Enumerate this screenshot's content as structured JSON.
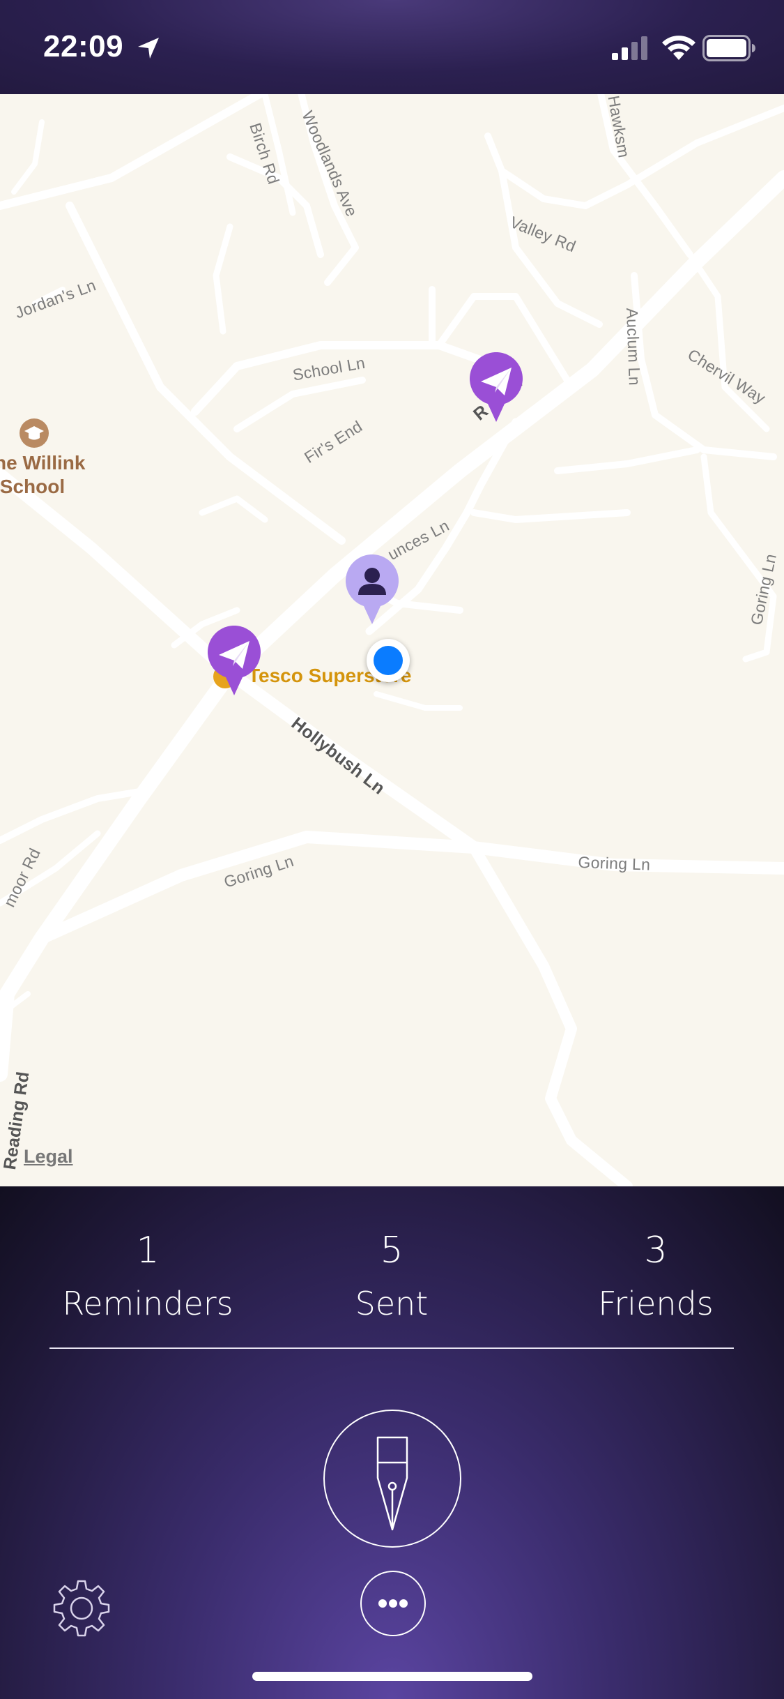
{
  "status_bar": {
    "time": "22:09",
    "icons": [
      "location-arrow-icon",
      "cellular-signal-icon",
      "wifi-icon",
      "battery-icon"
    ]
  },
  "map": {
    "streets": {
      "birch_rd": "Birch Rd",
      "woodlands_ave": "Woodlands Ave",
      "hawksmoor": "Hawksm",
      "valley_rd": "Valley Rd",
      "jordans_ln": "Jordan's Ln",
      "school_ln": "School Ln",
      "reading_rd_top": "R    g Rd",
      "auclum_ln": "Auclum Ln",
      "chervil_way": "Chervil Way",
      "firs_end": "Fir's End",
      "dunces_ln": "unces Ln",
      "goring_ln_right": "Goring Ln",
      "hollybush_ln": "Hollybush Ln",
      "goring_ln_left": "Goring Ln",
      "goring_ln_mid": "Goring Ln",
      "moor_rd": "moor Rd",
      "reading_rd_bottom": "Reading Rd"
    },
    "pois": {
      "school": "he Willink\n School",
      "tesco": "Tesco Superstore"
    },
    "pins": [
      "paper-plane-pin-icon",
      "paper-plane-pin-icon",
      "friend-pin-icon"
    ],
    "legal": "Legal",
    "colors": {
      "land": "#f9f6ee",
      "road": "#ffffff",
      "pin_purple": "#9a4fd6",
      "friend_pin": "#b9a9f2",
      "user_dot": "#0a7cff"
    }
  },
  "stats": {
    "reminders": {
      "value": "1",
      "label": "Reminders"
    },
    "sent": {
      "value": "5",
      "label": "Sent"
    },
    "friends": {
      "value": "3",
      "label": "Friends"
    }
  },
  "controls": {
    "compose": "fountain-pen-icon",
    "more": "ellipsis-icon",
    "settings": "gear-icon"
  }
}
